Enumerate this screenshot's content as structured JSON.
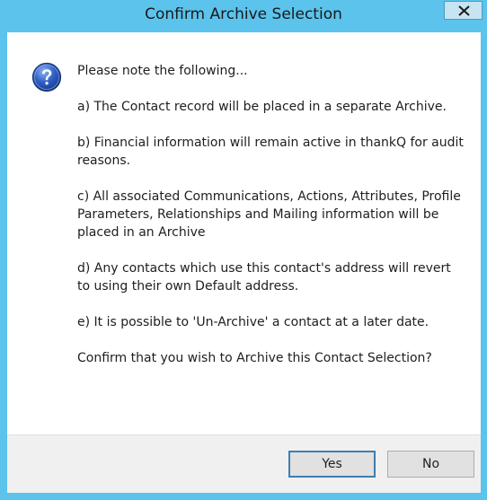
{
  "window": {
    "title": "Confirm Archive Selection",
    "close_icon": "close-icon"
  },
  "message": {
    "icon": "question-icon",
    "intro": "Please note the following...",
    "point_a": "a) The Contact record will be placed in a separate Archive.",
    "point_b": "b) Financial information will remain active in thankQ for audit reasons.",
    "point_c": "c) All associated Communications, Actions, Attributes, Profile Parameters, Relationships and Mailing information will be placed in an Archive",
    "point_d": "d) Any contacts which use this contact's address will revert to using their own Default address.",
    "point_e": "e) It is possible to 'Un-Archive' a contact at a later date.",
    "confirm": "Confirm that you wish to Archive this Contact Selection?"
  },
  "buttons": {
    "yes_label": "Yes",
    "no_label": "No"
  },
  "colors": {
    "title_bar": "#5bc3ec",
    "client_bg": "#ffffff",
    "footer_bg": "#f0f0f0",
    "default_button_border": "#3c7fb1"
  }
}
